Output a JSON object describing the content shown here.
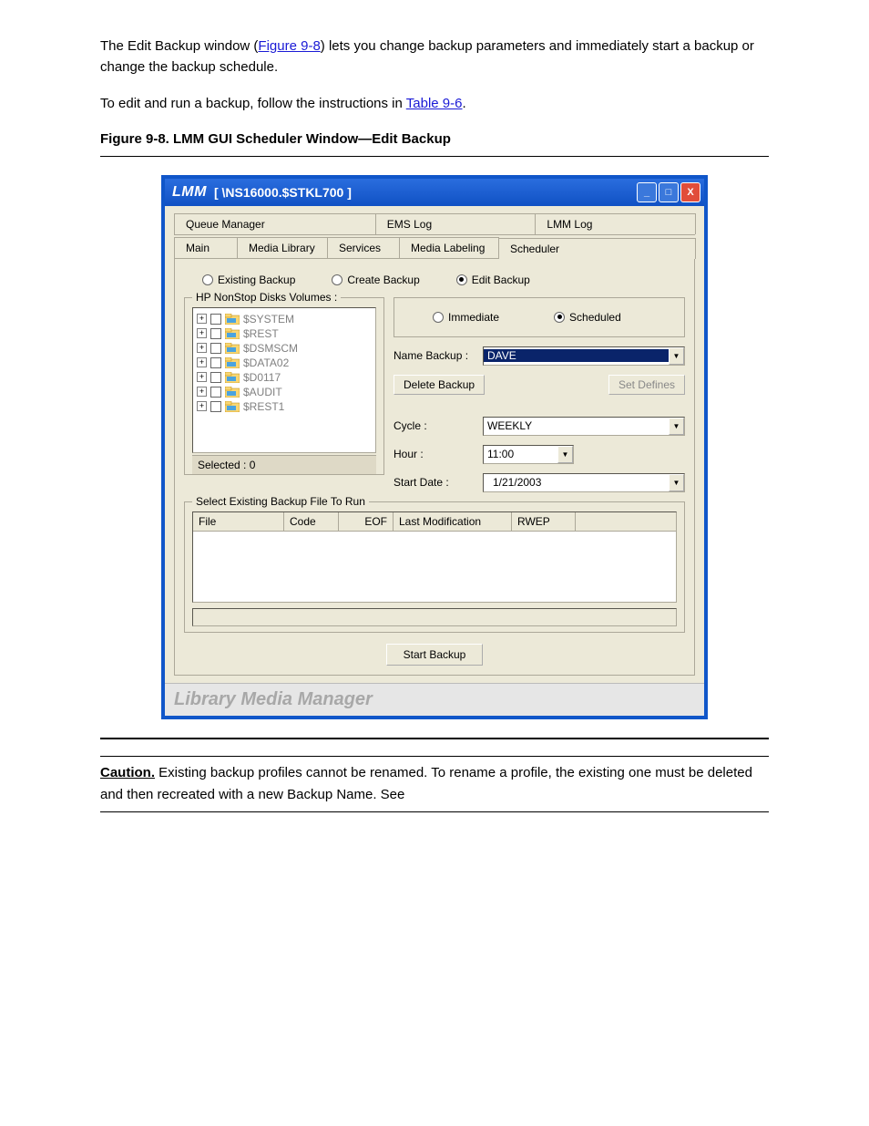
{
  "intro": {
    "p1_prefix": "The Edit Backup window (",
    "p1_link": "Figure 9-8",
    "p1_suffix": ") lets you change backup parameters and immediately start a backup or change the backup schedule.",
    "p2": "To edit and run a backup, follow the instructions in ",
    "p2_link": "Table 9-6",
    "p2_suffix": "."
  },
  "figure": {
    "label": "Figure 9-8. LMM GUI Scheduler Window—Edit Backup"
  },
  "window": {
    "title_main": "LMM",
    "title_sub": "[ \\NS16000.$STKL700 ]",
    "tabs_top": [
      "Queue Manager",
      "EMS Log",
      "LMM Log"
    ],
    "tabs_bottom": [
      "Main",
      "Media Library",
      "Services",
      "Media Labeling",
      "Scheduler"
    ],
    "mode": {
      "existing": "Existing Backup",
      "create": "Create Backup",
      "edit": "Edit Backup"
    },
    "disks": {
      "group_label": "HP NonStop Disks Volumes :",
      "items": [
        "$SYSTEM",
        "$REST",
        "$DSMSCM",
        "$DATA02",
        "$D0117",
        "$AUDIT",
        "$REST1"
      ],
      "selected_label": "Selected : 0"
    },
    "right": {
      "immediate": "Immediate",
      "scheduled": "Scheduled",
      "name_label": "Name Backup :",
      "name_value": "DAVE",
      "delete_btn": "Delete Backup",
      "setdef_btn": "Set Defines",
      "cycle_label": "Cycle :",
      "cycle_value": "WEEKLY",
      "hour_label": "Hour :",
      "hour_value": "11:00",
      "start_label": "Start Date :",
      "start_value": "1/21/2003"
    },
    "existing": {
      "group_label": "Select Existing Backup File To Run",
      "cols": [
        "File",
        "Code",
        "EOF",
        "Last Modification",
        "RWEP"
      ]
    },
    "start_btn": "Start Backup",
    "brand": "Library Media Manager"
  },
  "caution": {
    "label": "Caution.",
    "text": " Existing backup profiles cannot be renamed. To rename a profile, the existing one must be deleted and then recreated with a new Backup Name. See "
  }
}
